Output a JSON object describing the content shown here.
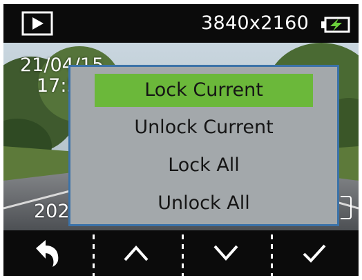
{
  "status": {
    "resolution": "3840x2160",
    "mode_icon": "playback-icon",
    "battery_icon": "battery-charging-icon"
  },
  "preview": {
    "date": "21/04/15",
    "time": "17:5",
    "stamp": "202"
  },
  "menu": {
    "items": [
      {
        "label": "Lock Current",
        "selected": true
      },
      {
        "label": "Unlock Current",
        "selected": false
      },
      {
        "label": "Lock All",
        "selected": false
      },
      {
        "label": "Unlock All",
        "selected": false
      }
    ]
  },
  "controls": {
    "icons": [
      "back-arrow-icon",
      "chevron-up-icon",
      "chevron-down-icon",
      "checkmark-icon"
    ]
  },
  "colors": {
    "selected": "#6bb83a",
    "menu_bg": "#a3a8ab",
    "menu_border": "#3b72a8",
    "battery_bolt": "#6bd13a"
  }
}
